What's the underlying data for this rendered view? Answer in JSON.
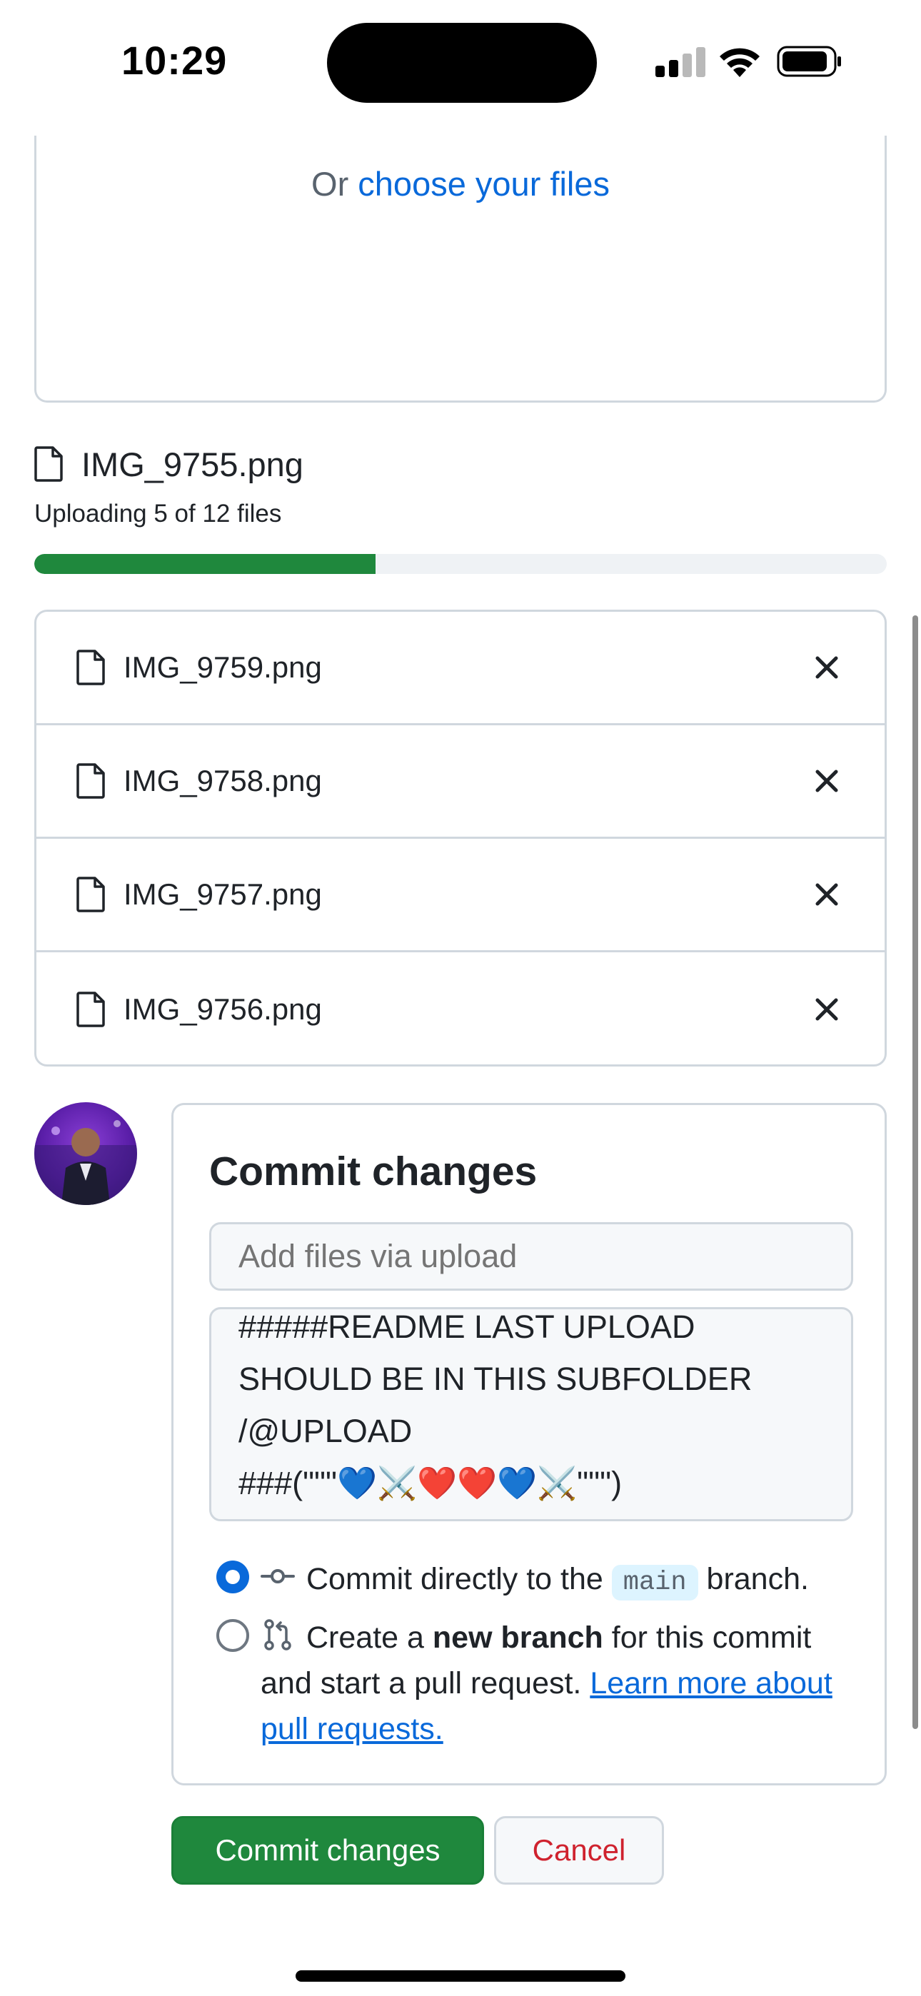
{
  "status_bar": {
    "time": "10:29"
  },
  "dropzone": {
    "prefix": "Or ",
    "choose_link": "choose your files"
  },
  "uploading": {
    "file_name": "IMG_9755.png",
    "status": "Uploading 5 of 12 files",
    "progress_fraction": 0.4
  },
  "queued_files": [
    {
      "name": "IMG_9759.png"
    },
    {
      "name": "IMG_9758.png"
    },
    {
      "name": "IMG_9757.png"
    },
    {
      "name": "IMG_9756.png"
    }
  ],
  "commit": {
    "title": "Commit changes",
    "summary_placeholder": "Add files via upload",
    "description": "#####README LAST UPLOAD\nSHOULD BE IN THIS SUBFOLDER\n/@UPLOAD\n###(\"\"\"💙⚔️❤️❤️💙⚔️\"\"\")",
    "option_direct": {
      "before": "Commit directly to the",
      "branch": "main",
      "after": "branch.",
      "selected": true
    },
    "option_new_branch": {
      "before": "Create a",
      "bold": "new branch",
      "after": "for this commit and start a pull request.",
      "link": "Learn more about pull requests.",
      "selected": false
    }
  },
  "buttons": {
    "commit": "Commit changes",
    "cancel": "Cancel"
  },
  "colors": {
    "accent": "#0969da",
    "success": "#1f883d",
    "danger": "#cf222e",
    "border": "#d0d7de"
  }
}
